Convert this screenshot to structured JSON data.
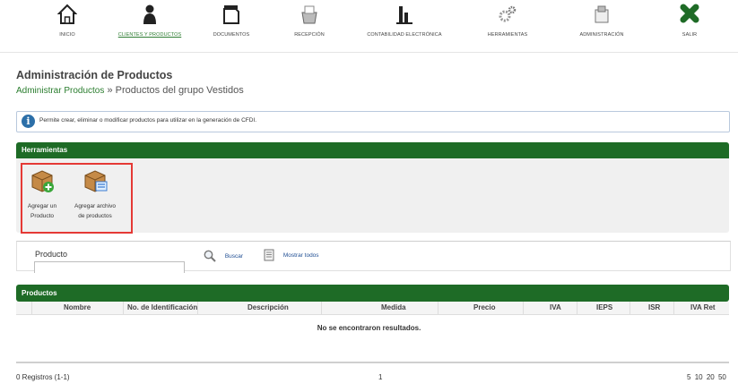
{
  "nav": {
    "items": [
      {
        "label": "INICIO",
        "icon": "home-icon"
      },
      {
        "label": "CLIENTES Y PRODUCTOS",
        "icon": "user-icon"
      },
      {
        "label": "DOCUMENTOS",
        "icon": "documents-icon"
      },
      {
        "label": "RECEPCIÓN",
        "icon": "reception-icon"
      },
      {
        "label": "CONTABILIDAD ELECTRÓNICA",
        "icon": "chart-icon"
      },
      {
        "label": "HERRAMIENTAS",
        "icon": "gears-icon"
      },
      {
        "label": "ADMINISTRACIÓN",
        "icon": "admin-icon"
      },
      {
        "label": "SALIR",
        "icon": "exit-icon"
      }
    ]
  },
  "page": {
    "title": "Administración de Productos",
    "breadcrumb_link": "Administrar Productos",
    "breadcrumb_sep": "»",
    "breadcrumb_current": "Productos del grupo Vestidos"
  },
  "info": {
    "text": "Permite crear, eliminar o modificar productos para utilizar en la generación de CFDI."
  },
  "tools": {
    "title": "Herramientas",
    "add_line1": "Agregar un",
    "add_line2": "Producto",
    "file_line1": "Agregar archivo",
    "file_line2": "de productos"
  },
  "search": {
    "label": "Producto",
    "value": "",
    "search_btn": "Buscar",
    "show_all_btn": "Mostrar todos"
  },
  "products": {
    "title": "Productos",
    "columns": [
      "Nombre",
      "No. de Identificación",
      "Descripción",
      "Medida",
      "Precio",
      "IVA",
      "IEPS",
      "ISR",
      "IVA Ret"
    ],
    "empty": "No se encontraron resultados."
  },
  "footer": {
    "records": "0 Registros (1-1)",
    "page": "1",
    "page_sizes": [
      "5",
      "10",
      "20",
      "50"
    ]
  },
  "colors": {
    "brand_green": "#1e6b26",
    "highlight_red": "#e53935",
    "info_blue": "#2c6fa8"
  }
}
